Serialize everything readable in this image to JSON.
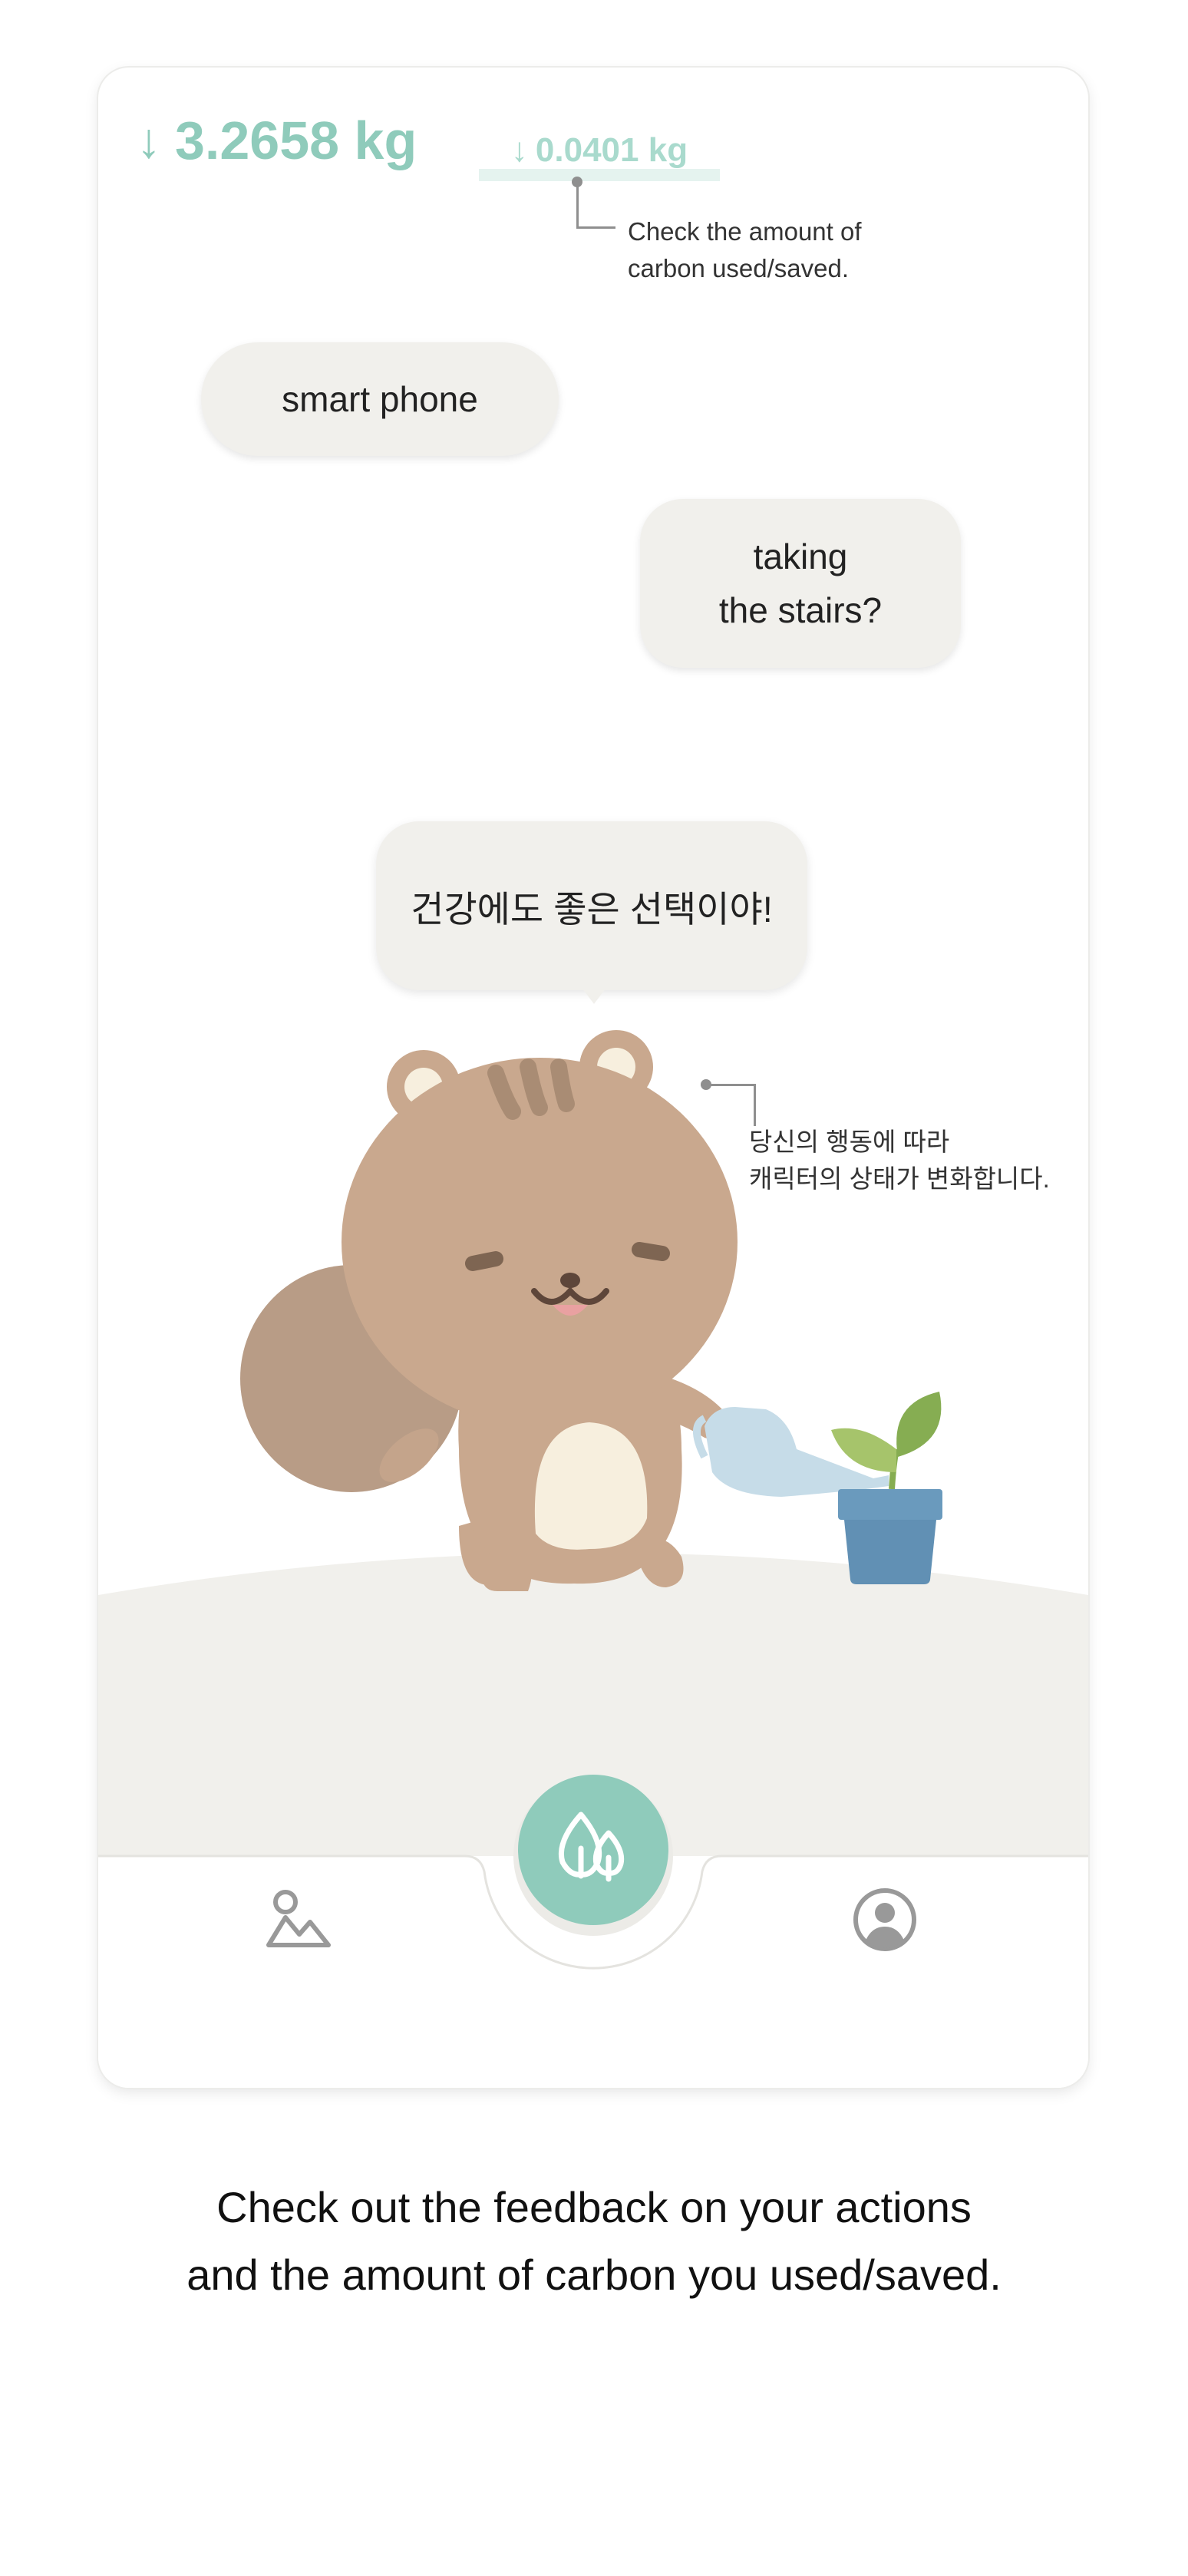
{
  "header": {
    "total_arrow": "↓",
    "total_value": "3.2658 kg",
    "delta_arrow": "↓",
    "delta_value": "0.0401 kg"
  },
  "notes": {
    "carbon_line1": "Check the amount of",
    "carbon_line2": "carbon used/saved.",
    "character_line1": "당신의 행동에 따라",
    "character_line2": "캐릭터의 상태가 변화합니다."
  },
  "bubbles": {
    "smart_phone": "smart phone",
    "stairs": "taking\nthe stairs?",
    "speech": "건강에도 좋은 선택이야!"
  },
  "nav": {
    "left_icon": "landscape-icon",
    "center_icon": "trees-icon",
    "right_icon": "profile-icon"
  },
  "caption": {
    "line1": "Check out the feedback on your actions",
    "line2": "and the amount of carbon you used/saved."
  },
  "colors": {
    "accent": "#8fcbbb",
    "accent_light": "#a9dacd",
    "bubble_bg": "#f1f0ec",
    "ground": "#f1f0ec",
    "squirrel": "#c9a88e",
    "pot": "#6190b4"
  }
}
